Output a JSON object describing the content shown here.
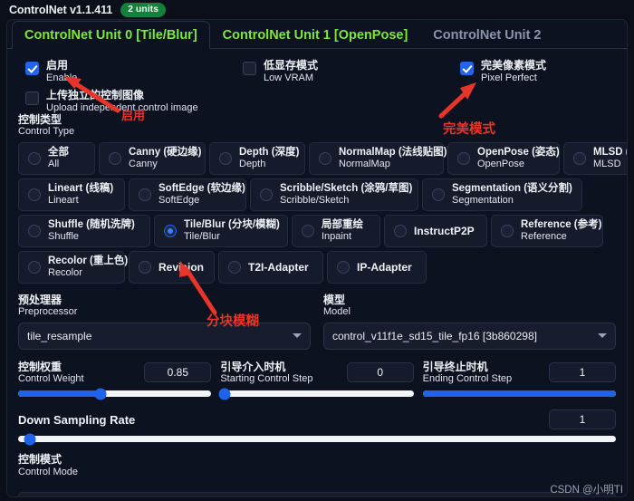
{
  "header": {
    "title": "ControlNet v1.1.411",
    "units_badge": "2 units"
  },
  "tabs": [
    {
      "label": "ControlNet Unit 0 [Tile/Blur]",
      "active": true
    },
    {
      "label": "ControlNet Unit 1 [OpenPose]",
      "active": false
    },
    {
      "label": "ControlNet Unit 2",
      "active": false
    }
  ],
  "checkboxes": {
    "enable": {
      "cn": "启用",
      "en": "Enable",
      "checked": true
    },
    "low_vram": {
      "cn": "低显存模式",
      "en": "Low VRAM",
      "checked": false
    },
    "pixel_perfect": {
      "cn": "完美像素模式",
      "en": "Pixel Perfect",
      "checked": true
    },
    "upload_independent": {
      "cn": "上传独立的控制图像",
      "en": "Upload independent control image",
      "checked": false
    }
  },
  "control_type": {
    "cn": "控制类型",
    "en": "Control Type",
    "selected": "Tile/Blur",
    "rows": [
      [
        {
          "cn": "全部",
          "en": "All",
          "selected": false
        },
        {
          "cn": "Canny (硬边缘)",
          "en": "Canny",
          "selected": false
        },
        {
          "cn": "Depth (深度)",
          "en": "Depth",
          "selected": false
        },
        {
          "cn": "NormalMap (法线贴图)",
          "en": "NormalMap",
          "selected": false
        },
        {
          "cn": "OpenPose (姿态)",
          "en": "OpenPose",
          "selected": false
        },
        {
          "cn": "MLSD (直线)",
          "en": "MLSD",
          "selected": false
        }
      ],
      [
        {
          "cn": "Lineart (线稿)",
          "en": "Lineart",
          "selected": false
        },
        {
          "cn": "SoftEdge (软边缘)",
          "en": "SoftEdge",
          "selected": false
        },
        {
          "cn": "Scribble/Sketch (涂鸦/草图)",
          "en": "Scribble/Sketch",
          "selected": false
        },
        {
          "cn": "Segmentation (语义分割)",
          "en": "Segmentation",
          "selected": false
        }
      ],
      [
        {
          "cn": "Shuffle (随机洗牌)",
          "en": "Shuffle",
          "selected": false
        },
        {
          "cn": "Tile/Blur (分块/模糊)",
          "en": "Tile/Blur",
          "selected": true
        },
        {
          "cn": "局部重绘",
          "en": "Inpaint",
          "selected": false
        },
        {
          "cn": "InstructP2P",
          "en": "",
          "selected": false
        },
        {
          "cn": "Reference (参考)",
          "en": "Reference",
          "selected": false
        }
      ],
      [
        {
          "cn": "Recolor (重上色)",
          "en": "Recolor",
          "selected": false
        },
        {
          "cn": "Revision",
          "en": "",
          "selected": false
        },
        {
          "cn": "T2I-Adapter",
          "en": "",
          "selected": false
        },
        {
          "cn": "IP-Adapter",
          "en": "",
          "selected": false
        }
      ]
    ]
  },
  "preprocessor": {
    "cn": "预处理器",
    "en": "Preprocessor",
    "value": "tile_resample"
  },
  "model": {
    "cn": "模型",
    "en": "Model",
    "value": "control_v11f1e_sd15_tile_fp16 [3b860298]"
  },
  "sliders": [
    {
      "cn": "控制权重",
      "en": "Control Weight",
      "value": "0.85",
      "percent": 42.5
    },
    {
      "cn": "引导介入时机",
      "en": "Starting Control Step",
      "value": "0",
      "percent": 0
    },
    {
      "cn": "引导终止时机",
      "en": "Ending Control Step",
      "value": "1",
      "percent": 100
    }
  ],
  "down_sampling": {
    "title": "Down Sampling Rate",
    "value": "1",
    "percent": 0
  },
  "control_mode": {
    "cn": "控制模式",
    "en": "Control Mode"
  },
  "annotations": [
    {
      "text": "启用",
      "color": "#e8352a"
    },
    {
      "text": "完美模式",
      "color": "#e8352a"
    },
    {
      "text": "分块模糊",
      "color": "#e8352a"
    }
  ],
  "watermark": "CSDN @小明TI",
  "colors": {
    "accent_green": "#7ce83a",
    "accent_blue": "#1e63e9",
    "badge_green": "#15803d",
    "annotation_red": "#e8352a",
    "panel_bg": "#0d1220"
  }
}
